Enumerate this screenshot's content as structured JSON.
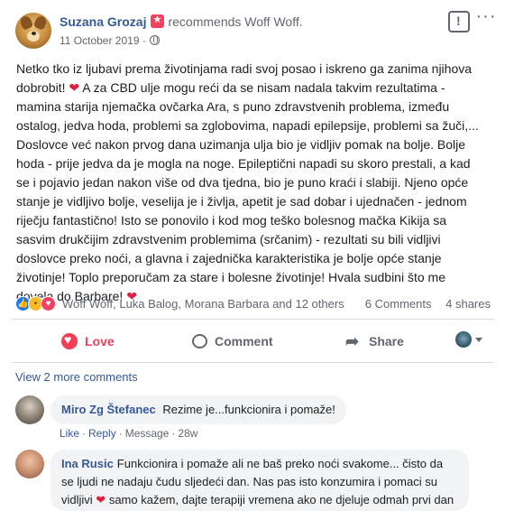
{
  "post": {
    "author": "Suzana Grozaj",
    "recommends_text": "recommends",
    "page_name": "Woff Woff.",
    "date": "11 October 2019",
    "body_lines": [
      "Netko tko iz ljubavi prema životinjama radi svoj posao i iskreno ga zanima njihova",
      "dobrobit! ❤ A za CBD ulje mogu reći da se nisam nadala takvim rezultatima -",
      "mamina starija njemačka ovčarka Ara, s puno zdravstvenih problema, između",
      "ostalog, jedva hoda, problemi sa zglobovima, napadi epilepsije, problemi sa žuči,...",
      "Doslovce već nakon prvog dana uzimanja ulja bio je vidljiv pomak na bolje. Bolje",
      "hoda - prije jedva da je mogla na noge. Epileptični napadi su skoro prestali, a kad",
      "se i pojavio jedan nakon više od dva tjedna, bio je puno kraći i slabiji. Njeno opće",
      "stanje je vidljivo bolje, veselija je i življa, apetit je sad dobar i ujednačen - jednom",
      "riječju fantastično! Isto se ponovilo i kod mog teško bolesnog mačka Kikija sa",
      "sasvim drukčijim zdravstvenim problemima (srčanim) - rezultati su bili vidljivi",
      "doslovce preko noći, a glavna i zajednička karakteristika je bolje opće stanje",
      "životinje! Toplo preporučam za stare i bolesne životinje! Hvala sudbini što me",
      "dovela do Barbare! ❤"
    ]
  },
  "reactions": {
    "icons": [
      "like",
      "wow",
      "love"
    ],
    "names": "Woff Woff, Luka Balog, Morana Barbara and 12 others",
    "comments_count": "6 Comments",
    "shares_count": "4 shares"
  },
  "actions": {
    "love_label": "Love",
    "comment_label": "Comment",
    "share_label": "Share"
  },
  "comments_section": {
    "view_more": "View 2 more comments",
    "comments": [
      {
        "name": "Miro Zg Štefanec",
        "text": "Rezime je...funkcionira i pomaže!",
        "like": "Like",
        "reply": "Reply",
        "message": "Message",
        "time": "28w"
      },
      {
        "name": "Ina Rusic",
        "text_lines": [
          "Funkcionira i pomaže ali ne baš preko noći svakome... čisto da",
          "se ljudi ne nadaju čudu sljedeći dan. Nas pas isto konzumira i pomaci su",
          "vidljivi ❤ samo kažem, dajte terapiji vremena ako ne djeluje odmah prvi dan"
        ]
      }
    ]
  },
  "colors": {
    "link_blue": "#385898",
    "love_red": "#f33e58",
    "muted_gray": "#606770",
    "bubble_bg": "#f2f3f5"
  }
}
